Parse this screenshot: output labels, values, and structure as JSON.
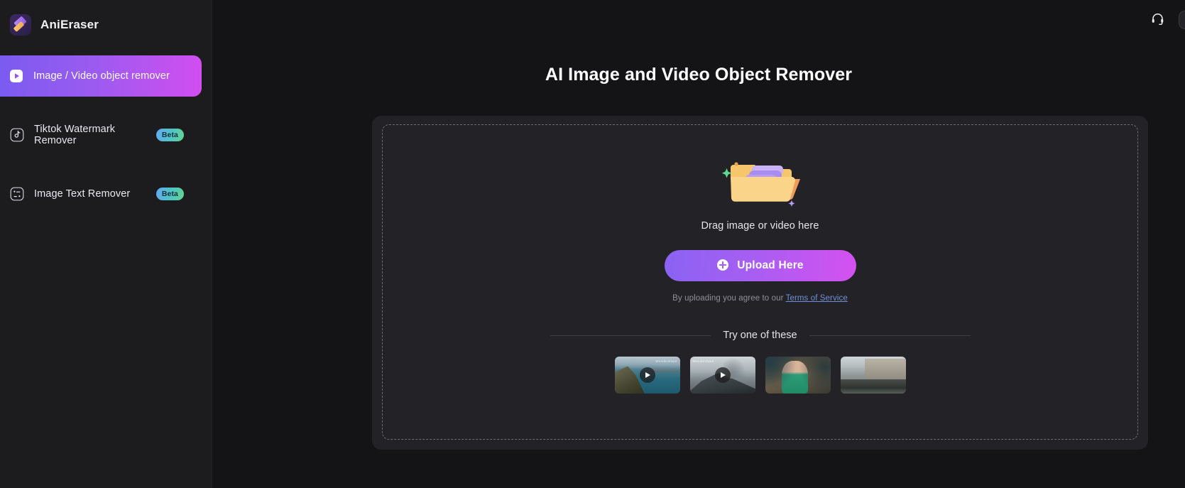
{
  "brand": {
    "name": "AniEraser",
    "logo_icon": "eraser-icon"
  },
  "sidebar": {
    "items": [
      {
        "label": "Image / Video object remover",
        "icon": "play-square-icon",
        "active": true,
        "badge": ""
      },
      {
        "label": "Tiktok Watermark Remover",
        "icon": "tiktok-note-icon",
        "active": false,
        "badge": "Beta"
      },
      {
        "label": "Image Text Remover",
        "icon": "text-remove-icon",
        "active": false,
        "badge": "Beta"
      }
    ]
  },
  "topbar": {
    "support_icon": "headset-icon"
  },
  "main": {
    "title": "AI Image and Video Object Remover",
    "dropzone": {
      "illustration_icon": "folder-sparkle-icon",
      "drag_text": "Drag image or video here",
      "upload_button": {
        "label": "Upload Here",
        "icon": "plus-circle-icon"
      },
      "terms_prefix": "By uploading you agree to our ",
      "terms_link": "Terms of Service",
      "samples_label": "Try one of these",
      "samples": [
        {
          "name": "coastal-cliff-video",
          "watermark": "Wondershare",
          "play_icon": "play-icon"
        },
        {
          "name": "volcano-video",
          "watermark": "Wondershare",
          "play_icon": "play-icon"
        },
        {
          "name": "woman-on-rocks-image",
          "watermark": "",
          "play_icon": ""
        },
        {
          "name": "city-street-image",
          "watermark": "",
          "play_icon": ""
        }
      ]
    }
  },
  "colors": {
    "accent_start": "#8a63f3",
    "accent_end": "#d551ef",
    "page_bg": "#141416",
    "sidebar_bg": "#1c1c1f",
    "card_bg": "#232327",
    "link": "#6f8fd8",
    "badge_start": "#63a8f2",
    "badge_end": "#62d392"
  }
}
